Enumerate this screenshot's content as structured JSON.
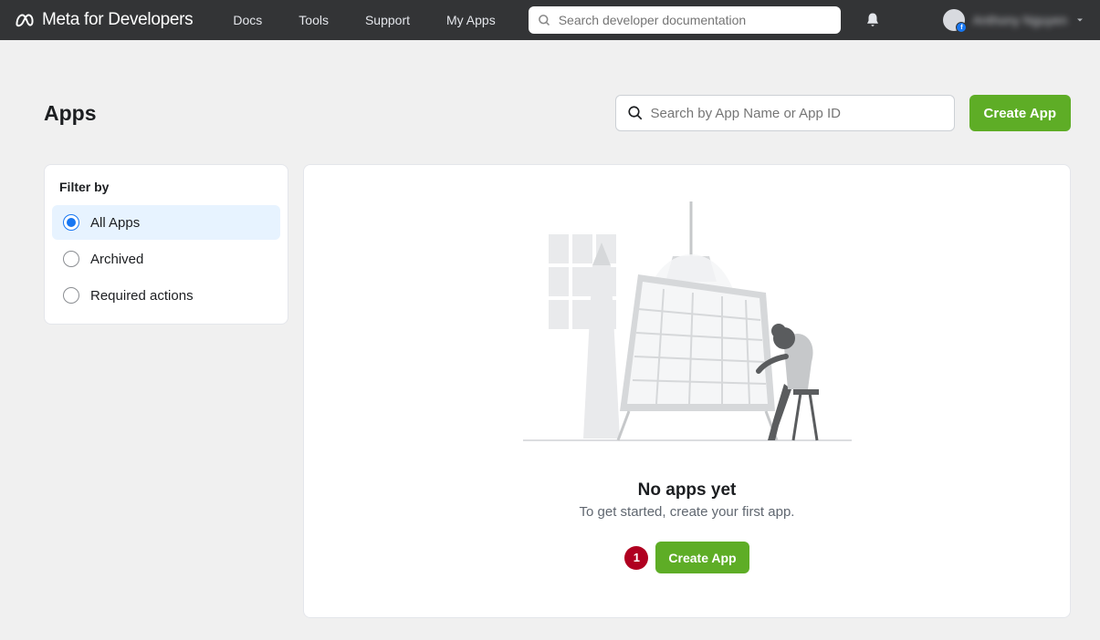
{
  "header": {
    "brand": "Meta for Developers",
    "nav": {
      "docs": "Docs",
      "tools": "Tools",
      "support": "Support",
      "myapps": "My Apps"
    },
    "search_placeholder": "Search developer documentation",
    "user_name": "Anthony Nguyen"
  },
  "page": {
    "title": "Apps",
    "app_search_placeholder": "Search by App Name or App ID",
    "create_button": "Create App"
  },
  "filter": {
    "title": "Filter by",
    "items": {
      "all": "All Apps",
      "archived": "Archived",
      "required": "Required actions"
    }
  },
  "empty": {
    "title": "No apps yet",
    "subtitle": "To get started, create your first app.",
    "badge": "1",
    "button": "Create App"
  }
}
